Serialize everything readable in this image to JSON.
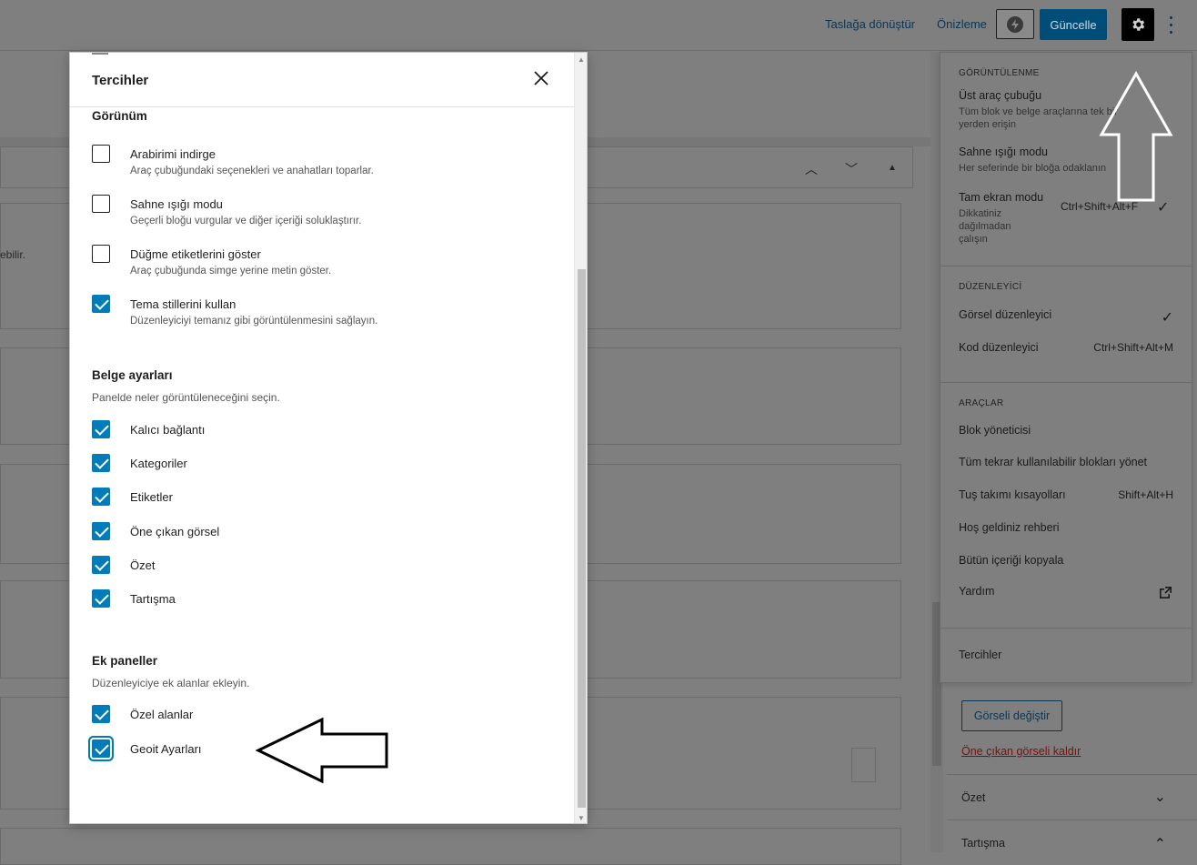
{
  "topbar": {
    "draft_label": "Taslağa dönüştür",
    "preview_label": "Önizleme",
    "update_label": "Güncelle",
    "launch_icon": "bolt-icon",
    "settings_icon": "gear-icon",
    "more_icon": "vertical-dots-icon"
  },
  "background": {
    "partial_text": "ebilir."
  },
  "menu": {
    "view": {
      "title": "GÖRÜNTÜLENME",
      "items": [
        {
          "label": "Üst araç çubuğu",
          "desc": "Tüm blok ve belge araçlarına tek bir yerden erişin",
          "shortcut": "",
          "checked": false
        },
        {
          "label": "Sahne ışığı modu",
          "desc": "Her seferinde bir bloğa odaklanın",
          "shortcut": "",
          "checked": false
        },
        {
          "label": "Tam ekran modu",
          "desc": "Dikkatiniz dağılmadan çalışın",
          "shortcut": "Ctrl+Shift+Alt+F",
          "checked": true
        }
      ]
    },
    "editor": {
      "title": "DÜZENLEYİCİ",
      "items": [
        {
          "label": "Görsel düzenleyici",
          "shortcut": "",
          "checked": true
        },
        {
          "label": "Kod düzenleyici",
          "shortcut": "Ctrl+Shift+Alt+M",
          "checked": false
        }
      ]
    },
    "tools": {
      "title": "ARAÇLAR",
      "items": [
        {
          "label": "Blok yöneticisi",
          "shortcut": ""
        },
        {
          "label": "Tüm tekrar kullanılabilir blokları yönet",
          "shortcut": ""
        },
        {
          "label": "Tuş takımı kısayolları",
          "shortcut": "Shift+Alt+H"
        },
        {
          "label": "Hoş geldiniz rehberi",
          "shortcut": ""
        },
        {
          "label": "Bütün içeriği kopyala",
          "shortcut": ""
        },
        {
          "label": "Yardım",
          "shortcut": "",
          "icon": "external-link-icon"
        }
      ]
    },
    "preferences_label": "Tercihler"
  },
  "sidebar": {
    "replace_image_label": "Görseli değiştir",
    "remove_image_label": "Öne çıkan görseli kaldır",
    "excerpt_label": "Özet",
    "discussion_label": "Tartışma"
  },
  "modal": {
    "title": "Tercihler",
    "close_icon": "close-icon",
    "appearance": {
      "title": "Görünüm",
      "options": [
        {
          "label": "Arabirimi indirge",
          "help": "Araç çubuğundaki seçenekleri ve anahatları toparlar.",
          "checked": false
        },
        {
          "label": "Sahne ışığı modu",
          "help": "Geçerli bloğu vurgular ve diğer içeriği soluklaştırır.",
          "checked": false
        },
        {
          "label": "Düğme etiketlerini göster",
          "help": "Araç çubuğunda simge yerine metin göster.",
          "checked": false
        },
        {
          "label": "Tema stillerini kullan",
          "help": "Düzenleyiciyi temanız gibi görüntülenmesini sağlayın.",
          "checked": true
        }
      ]
    },
    "document": {
      "title": "Belge ayarları",
      "desc": "Panelde neler görüntüleneceğini seçin.",
      "options": [
        {
          "label": "Kalıcı bağlantı",
          "checked": true
        },
        {
          "label": "Kategoriler",
          "checked": true
        },
        {
          "label": "Etiketler",
          "checked": true
        },
        {
          "label": "Öne çıkan görsel",
          "checked": true
        },
        {
          "label": "Özet",
          "checked": true
        },
        {
          "label": "Tartışma",
          "checked": true
        }
      ]
    },
    "extra": {
      "title": "Ek paneller",
      "desc": "Düzenleyiciye ek alanlar ekleyin.",
      "options": [
        {
          "label": "Özel alanlar",
          "checked": true
        },
        {
          "label": "Geoit Ayarları",
          "checked": true
        }
      ]
    }
  },
  "annotations": {
    "arrow_up_icon": "arrow-up-annotation",
    "arrow_left_icon": "arrow-left-annotation"
  }
}
